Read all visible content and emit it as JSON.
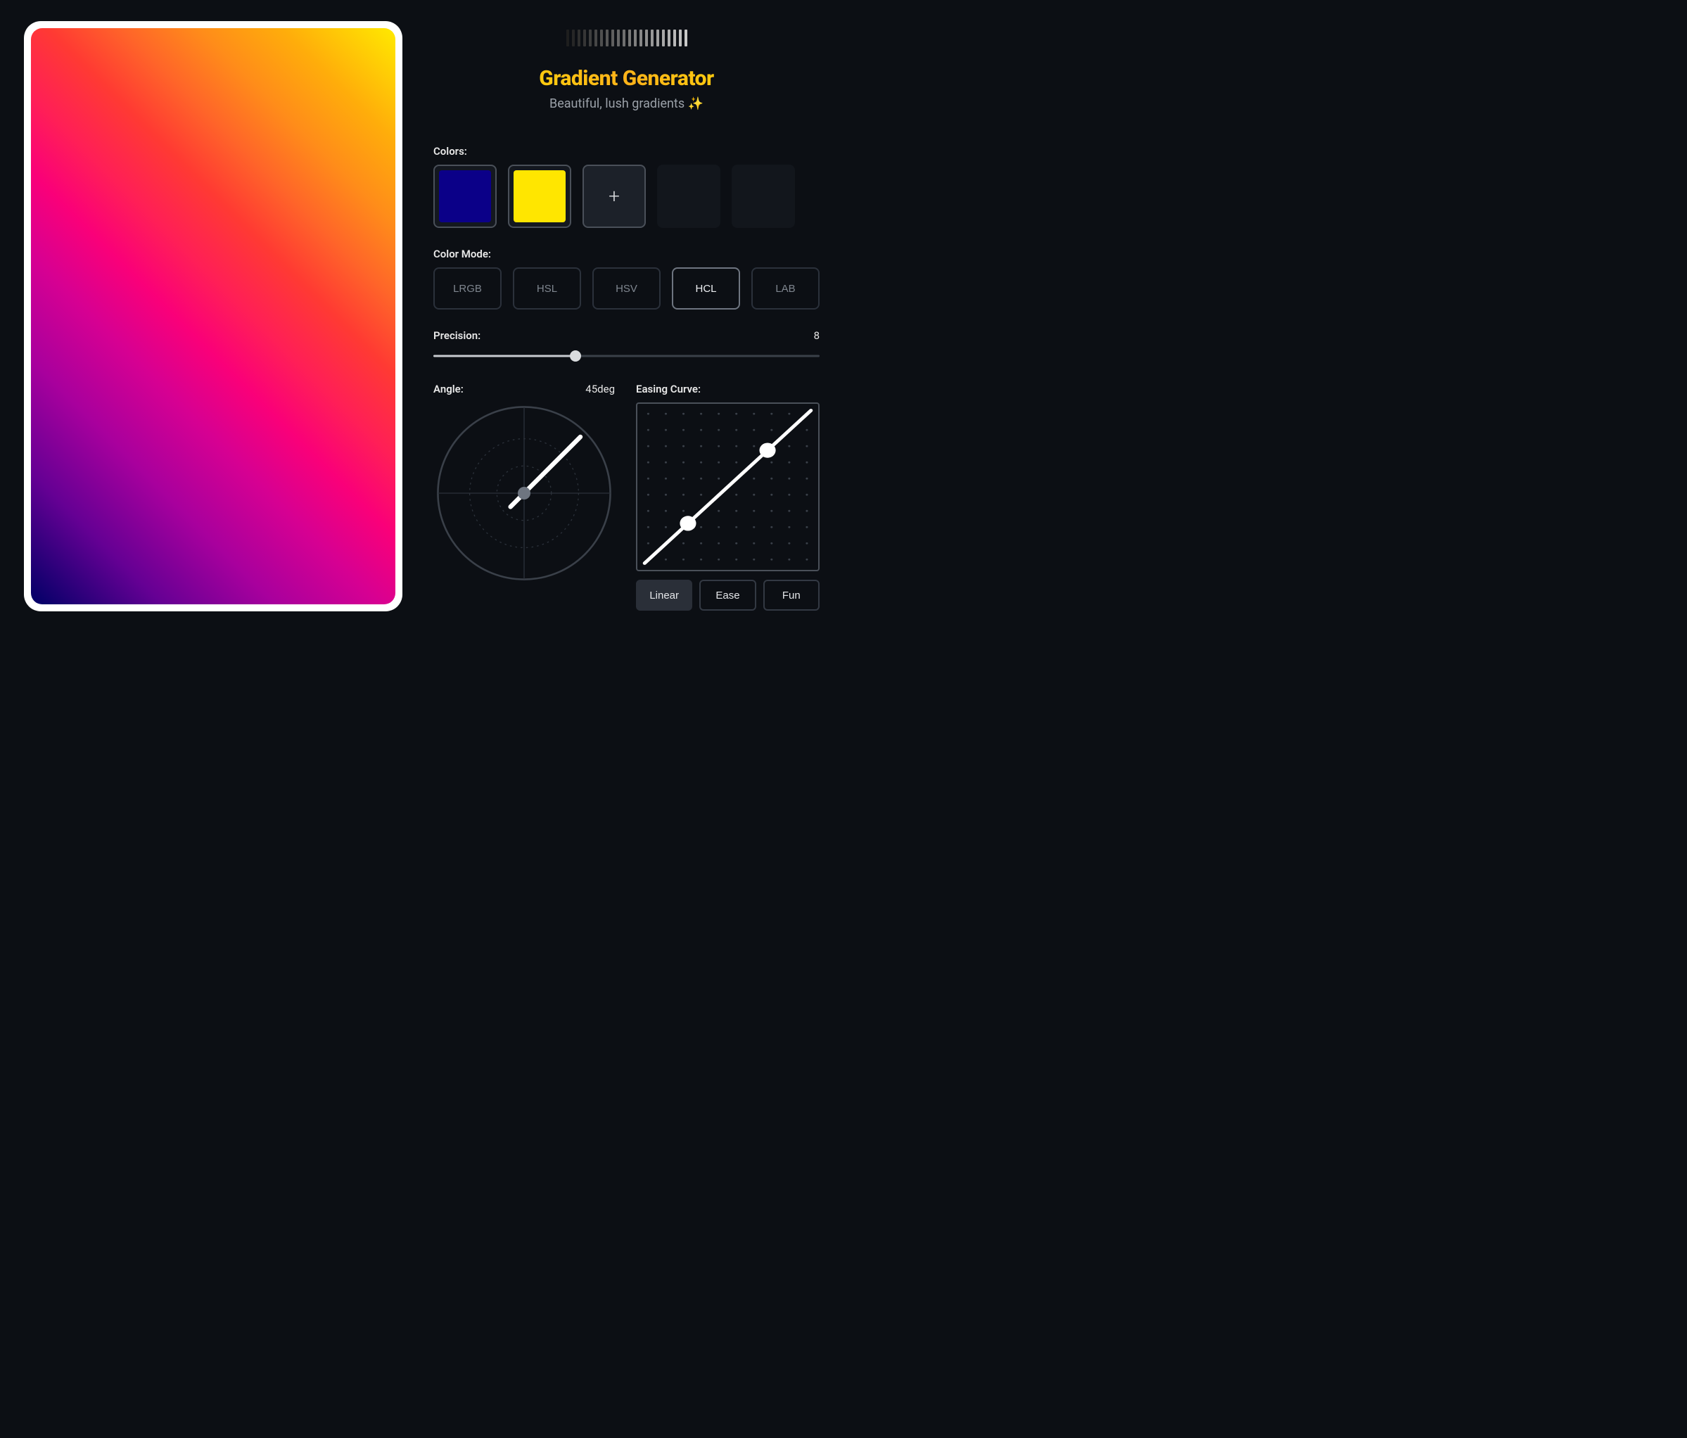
{
  "header": {
    "title": "Gradient Generator",
    "subtitle": "Beautiful, lush gradients ✨"
  },
  "colors": {
    "label": "Colors:",
    "swatches": [
      "#0b0088",
      "#ffe600"
    ],
    "max_slots": 5
  },
  "color_mode": {
    "label": "Color Mode:",
    "options": [
      "LRGB",
      "HSL",
      "HSV",
      "HCL",
      "LAB"
    ],
    "selected": "HCL"
  },
  "precision": {
    "label": "Precision:",
    "value": 8,
    "min": 1,
    "max": 20
  },
  "angle": {
    "label": "Angle:",
    "value": "45deg",
    "degrees": 45
  },
  "easing": {
    "label": "Easing Curve:",
    "presets": [
      "Linear",
      "Ease",
      "Fun"
    ],
    "selected": "Linear",
    "control_points": [
      [
        0.25,
        0.25
      ],
      [
        0.75,
        0.75
      ]
    ]
  },
  "preview_gradient_stops": [
    "hsl(240deg 100% 20%)",
    "hsl(281deg 100% 29%)",
    "hsl(304deg 100% 33%)",
    "hsl(319deg 100% 42%)",
    "hsl(331deg 100% 49%)",
    "hsl(345deg 100% 56%)",
    "hsl(2deg 100% 60%)",
    "hsl(17deg 100% 58%)",
    "hsl(30deg 100% 55%)",
    "hsl(40deg 100% 52%)",
    "hsl(55deg 100% 50%)"
  ]
}
